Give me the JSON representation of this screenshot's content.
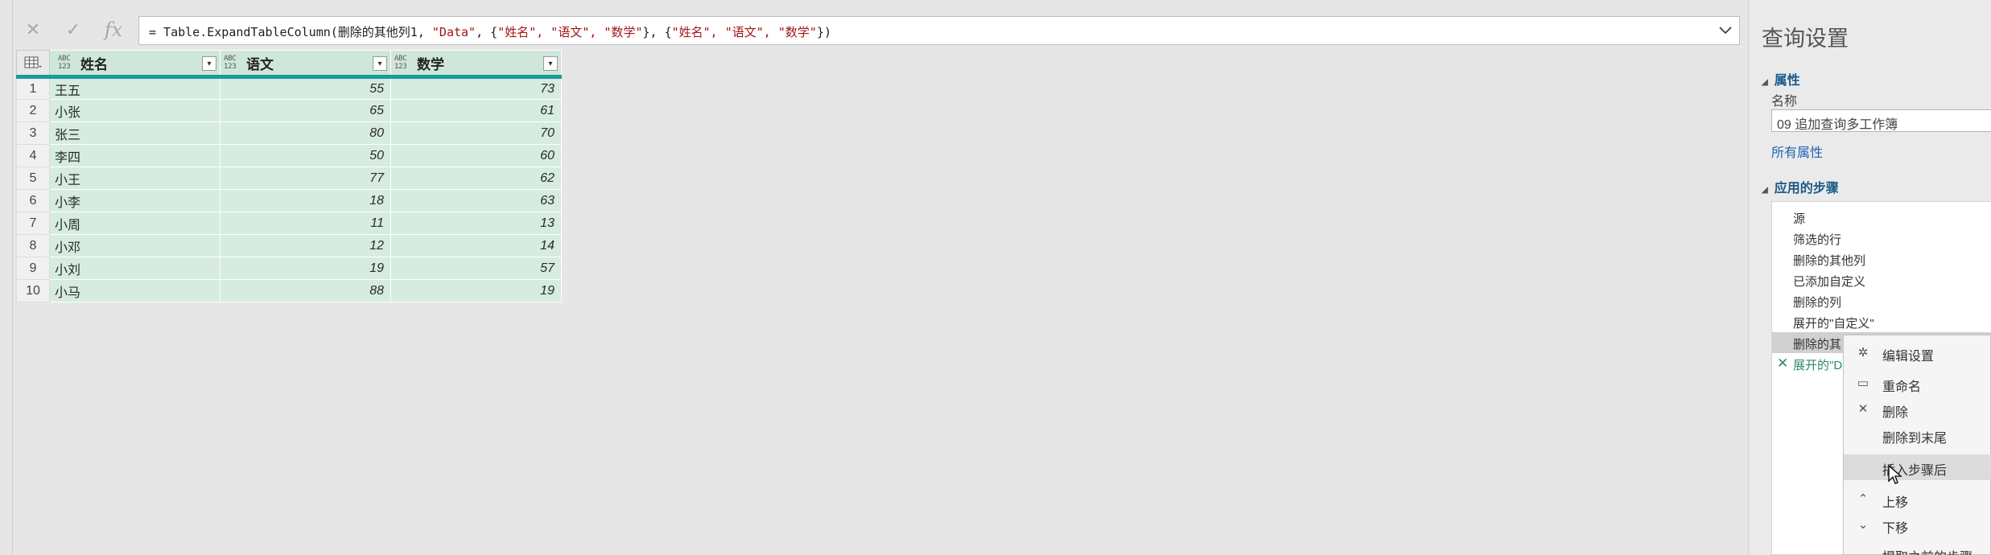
{
  "formula_bar": {
    "cancel_icon": "✕",
    "commit_icon": "✓",
    "fx_label": "fx",
    "prefix": "= Table.ExpandTableColumn(删除的其他列1, ",
    "arg1": "\"Data\"",
    "sep1": ", {",
    "cols1": "\"姓名\", \"语文\", \"数学\"",
    "sep2": "}, {",
    "cols2": "\"姓名\", \"语文\", \"数学\"",
    "suffix": "})"
  },
  "grid": {
    "columns": [
      {
        "type_top": "ABC",
        "type_bottom": "123",
        "name": "姓名"
      },
      {
        "type_top": "ABC",
        "type_bottom": "123",
        "name": "语文"
      },
      {
        "type_top": "ABC",
        "type_bottom": "123",
        "name": "数学"
      }
    ],
    "rows": [
      {
        "n": "1",
        "name": "王五",
        "chinese": "55",
        "math": "73"
      },
      {
        "n": "2",
        "name": "小张",
        "chinese": "65",
        "math": "61"
      },
      {
        "n": "3",
        "name": "张三",
        "chinese": "80",
        "math": "70"
      },
      {
        "n": "4",
        "name": "李四",
        "chinese": "50",
        "math": "60"
      },
      {
        "n": "5",
        "name": "小王",
        "chinese": "77",
        "math": "62"
      },
      {
        "n": "6",
        "name": "小李",
        "chinese": "18",
        "math": "63"
      },
      {
        "n": "7",
        "name": "小周",
        "chinese": "11",
        "math": "13"
      },
      {
        "n": "8",
        "name": "小邓",
        "chinese": "12",
        "math": "14"
      },
      {
        "n": "9",
        "name": "小刘",
        "chinese": "19",
        "math": "57"
      },
      {
        "n": "10",
        "name": "小马",
        "chinese": "88",
        "math": "19"
      }
    ]
  },
  "query_settings": {
    "title": "查询设置",
    "properties_heading": "属性",
    "name_label": "名称",
    "name_value": "09 追加查询多工作簿",
    "all_properties_link": "所有属性",
    "applied_steps_heading": "应用的步骤",
    "steps": [
      {
        "label": "源",
        "gear": true
      },
      {
        "label": "筛选的行",
        "gear": true
      },
      {
        "label": "删除的其他列",
        "gear": true
      },
      {
        "label": "已添加自定义",
        "gear": true
      },
      {
        "label": "删除的列",
        "gear": false
      },
      {
        "label": "展开的\"自定义\"",
        "gear": true
      },
      {
        "label": "删除的其",
        "gear": false
      },
      {
        "label": "展开的\"D",
        "gear": false
      }
    ]
  },
  "context_menu": {
    "items": [
      {
        "label": "编辑设置",
        "icon": "gear-icon"
      },
      {
        "label": "重命名",
        "icon": "rename-icon"
      },
      {
        "label": "删除",
        "icon": "close-icon"
      },
      {
        "label": "删除到末尾",
        "icon": ""
      },
      {
        "label": "插入步骤后",
        "icon": ""
      },
      {
        "label": "上移",
        "icon": "chevron-up-icon"
      },
      {
        "label": "下移",
        "icon": "chevron-down-icon"
      },
      {
        "label": "提取之前的步骤",
        "icon": ""
      }
    ]
  },
  "colors": {
    "header_underline": "#1a9b9b",
    "grid_fill": "#d6ece0",
    "link": "#1e64b4",
    "active_step": "#2b8a6b"
  }
}
